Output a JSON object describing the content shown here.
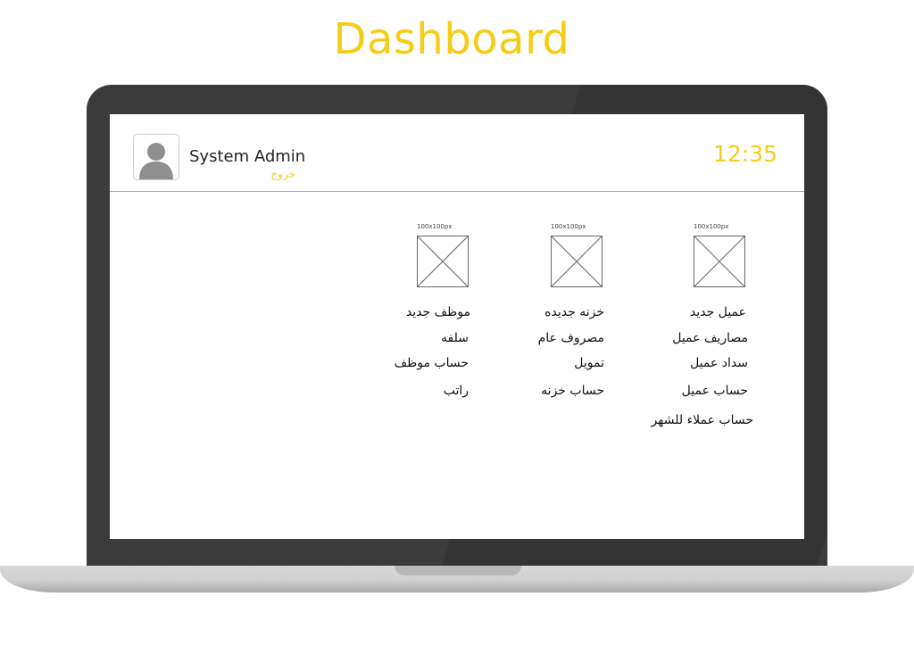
{
  "page": {
    "title": "Dashboard"
  },
  "header": {
    "user_name": "System Admin",
    "logout_label": "خروج",
    "clock": "12:35"
  },
  "columns": [
    {
      "image_caption": "100x100px",
      "items": [
        "موظف جديد",
        "سلفه",
        "حساب موظف",
        "راتب"
      ]
    },
    {
      "image_caption": "100x100px",
      "items": [
        "خزنه جديده",
        "مصروف عام",
        "تمويل",
        "حساب خزنه"
      ]
    },
    {
      "image_caption": "100x100px",
      "items": [
        "عميل جديد",
        "مصاريف عميل",
        "سداد عميل",
        "حساب عميل",
        "حساب عملاء للشهر"
      ]
    }
  ],
  "colors": {
    "accent": "#f7cc17",
    "divider": "#6fb7dc",
    "laptop_frame": "#3b3b3b"
  },
  "icons": {
    "avatar": "user-silhouette-icon",
    "placeholder": "image-placeholder-icon"
  }
}
